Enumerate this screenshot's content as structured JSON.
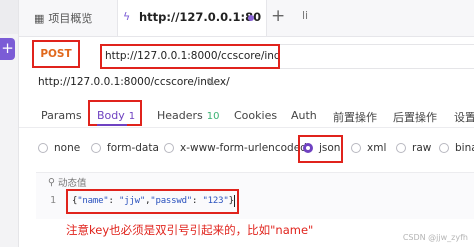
{
  "tabs": {
    "project": "项目概览",
    "active_url": "http://127.0.0.1:80",
    "more": "li"
  },
  "request": {
    "method": "POST",
    "url": "http://127.0.0.1:8000/ccscore/index/",
    "name": "http://127.0.0.1:8000/ccscore/index/"
  },
  "subtabs": [
    {
      "label": "Params"
    },
    {
      "label": "Body",
      "count": "1"
    },
    {
      "label": "Headers",
      "count": "10"
    },
    {
      "label": "Cookies"
    },
    {
      "label": "Auth"
    },
    {
      "label": "前置操作"
    },
    {
      "label": "后置操作"
    },
    {
      "label": "设置"
    }
  ],
  "body_types": [
    "none",
    "form-data",
    "x-www-form-urlencoded",
    "json",
    "xml",
    "raw",
    "bina"
  ],
  "selected_body_type": "json",
  "editor": {
    "dynamic_label": "动态值",
    "line_number": "1",
    "code_open": "{",
    "k1": "\"name\"",
    "v1": "\"jjw\"",
    "k2": "\"passwd\"",
    "v2": "\"123\"",
    "code_close": "}"
  },
  "note": "注意key也必须是双引号引起来的，比如\"name\"",
  "watermark": "CSDN @jjw_zyfh",
  "colors": {
    "accent": "#6f42c1",
    "highlight_box": "#e0231c",
    "method": "#e0681c",
    "count": "#3bb273"
  }
}
